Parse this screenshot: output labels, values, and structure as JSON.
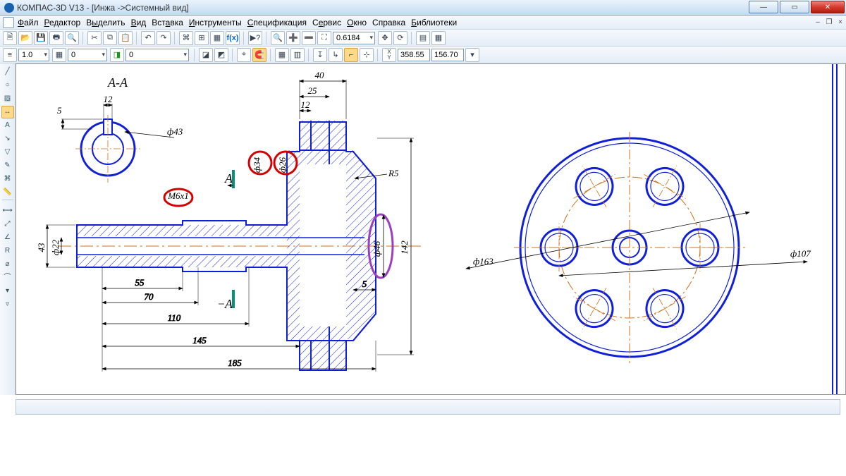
{
  "title": "КОМПАС-3D V13 - [Инжа ->Системный вид]",
  "menu": [
    "Файл",
    "Редактор",
    "Выделить",
    "Вид",
    "Вставка",
    "Инструменты",
    "Спецификация",
    "Сервис",
    "Окно",
    "Справка",
    "Библиотеки"
  ],
  "toolbar1": {
    "zoom_value": "0.6184"
  },
  "toolbar2": {
    "spin1": "1.0",
    "spin2": "0",
    "layer": "0",
    "coord_x": "358.55",
    "coord_y": "156.70"
  },
  "drawing": {
    "section_label": "А-А",
    "marker_top": "А",
    "marker_bottom": "А",
    "dims": {
      "d40": "40",
      "d25": "25",
      "d12": "12",
      "d12b": "12",
      "d5": "5",
      "r5": "R5",
      "d43": "ф43",
      "d34": "ф34",
      "d26": "ф26",
      "m6": "М6х1",
      "d46": "ф46",
      "d142": "142",
      "d43v": "43",
      "d22": "ф22",
      "d22v": "ф22",
      "l55": "55",
      "l70": "70",
      "l110": "110",
      "l145": "145",
      "l185": "185",
      "h5": "5",
      "d163": "ф163",
      "d107": "ф107"
    }
  }
}
